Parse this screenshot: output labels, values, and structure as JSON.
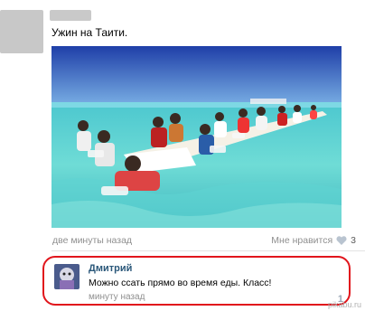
{
  "post": {
    "text": "Ужин на Таити.",
    "time": "две минуты назад",
    "like_label": "Мне нравится",
    "like_count": "3",
    "like_icon": "heart-icon"
  },
  "comment": {
    "author": "Дмитрий",
    "text": "Можно ссать прямо во время еды. Класс!",
    "time": "минуту назад",
    "likes": "1"
  },
  "watermark": "pikabu.ru",
  "colors": {
    "highlight_border": "#e1151c",
    "author_link": "#2b587a",
    "muted_text": "#8f8f8f"
  }
}
